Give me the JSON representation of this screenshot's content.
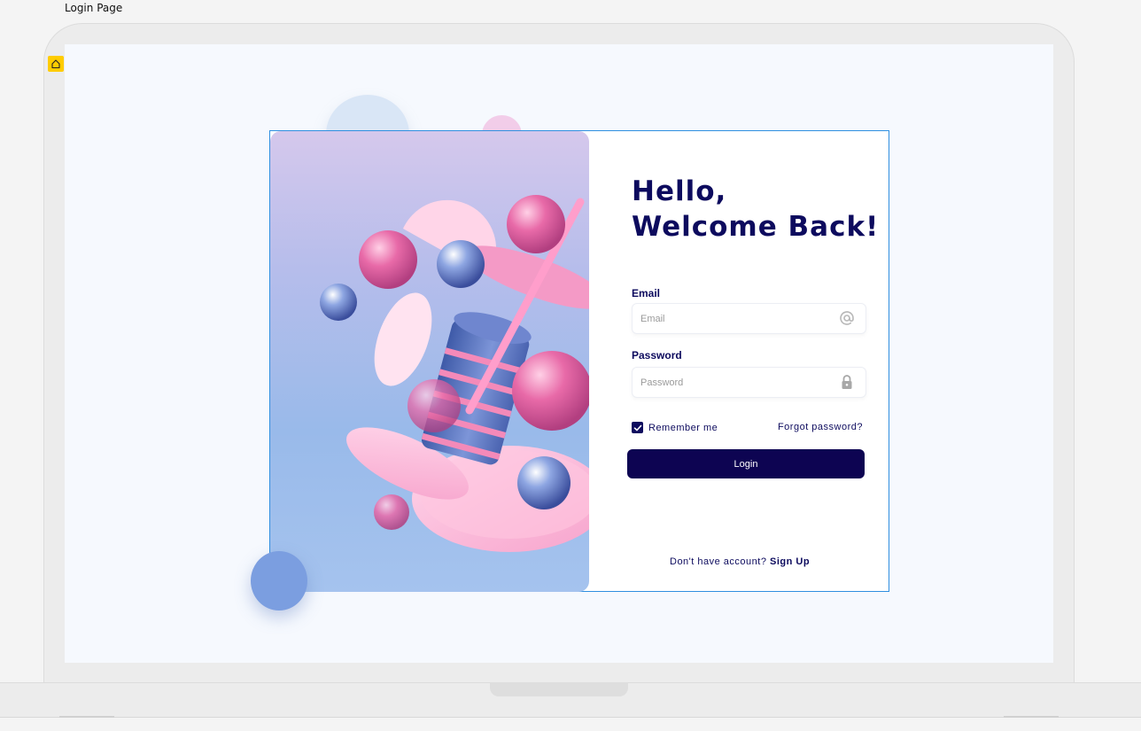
{
  "frame": {
    "label": "Login Page"
  },
  "login": {
    "title_line1": "Hello,",
    "title_line2": "Welcome Back!",
    "email_label": "Email",
    "email_placeholder": "Email",
    "email_icon": "at-sign-icon",
    "password_label": "Password",
    "password_placeholder": "Password",
    "password_icon": "lock-icon",
    "remember_label": "Remember me",
    "remember_checked": true,
    "forgot_label": "Forgot password?",
    "login_button": "Login",
    "signup_prompt": "Don't have account?",
    "signup_link": "Sign Up"
  },
  "colors": {
    "primary": "#0d0452",
    "heading": "#0d0b5e",
    "selection_outline": "#2f8fe0",
    "home_badge": "#ffcc00",
    "screen_bg": "#f6f9fe"
  }
}
